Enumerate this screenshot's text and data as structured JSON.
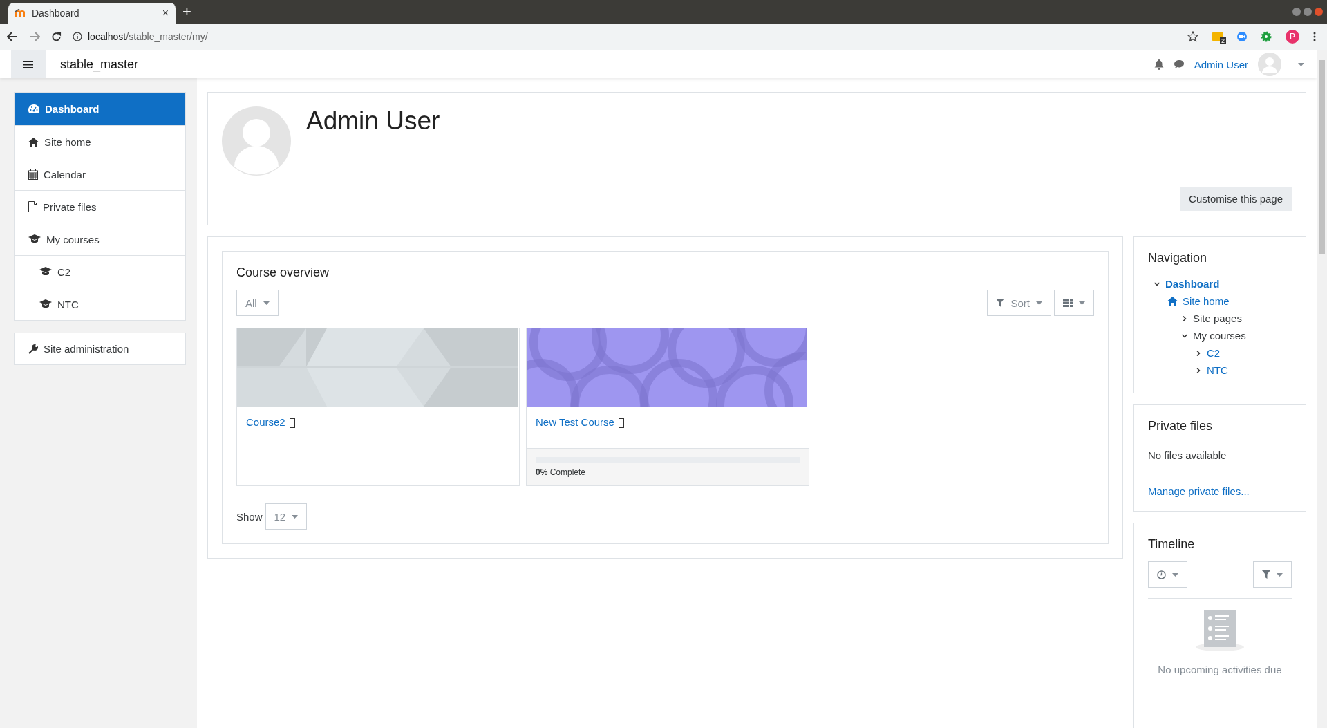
{
  "browser": {
    "tab_title": "Dashboard",
    "tab_close": "×",
    "new_tab": "+",
    "url_host": "localhost",
    "url_path": "/stable_master/my/",
    "extension_badge": "2",
    "profile_initial": "P"
  },
  "navbar": {
    "site_name": "stable_master",
    "user_name": "Admin User"
  },
  "drawer": {
    "items": [
      {
        "label": "Dashboard",
        "kind": "dashboard",
        "selected": true
      },
      {
        "label": "Site home",
        "kind": "home",
        "selected": false
      },
      {
        "label": "Calendar",
        "kind": "calendar",
        "selected": false
      },
      {
        "label": "Private files",
        "kind": "file",
        "selected": false
      },
      {
        "label": "My courses",
        "kind": "courses",
        "selected": false,
        "children": [
          {
            "label": "C2",
            "kind": "courses",
            "selected": false
          },
          {
            "label": "NTC",
            "kind": "courses",
            "selected": false
          }
        ]
      }
    ],
    "admin": {
      "label": "Site administration"
    }
  },
  "header": {
    "name": "Admin User",
    "customise_button": "Customise this page"
  },
  "course_overview": {
    "title": "Course overview",
    "filter": "All",
    "sort": "Sort",
    "courses": [
      {
        "name": "Course2",
        "kind": "hexagons"
      },
      {
        "name": "New Test Course",
        "kind": "circles",
        "progress": {
          "level": 0,
          "percent": "0%",
          "label": "Complete"
        }
      }
    ],
    "show_label": "Show",
    "per_page": "12"
  },
  "navigation_block": {
    "title": "Navigation",
    "tree": [
      {
        "label": "Dashboard",
        "kind": "branch",
        "expanded": true,
        "link": true,
        "current": true,
        "children": [
          {
            "label": "Site home",
            "kind": "home",
            "link": true,
            "current": false,
            "children": [
              {
                "label": "Site pages",
                "kind": "branch",
                "expanded": false,
                "link": false,
                "current": false
              },
              {
                "label": "My courses",
                "kind": "branch",
                "expanded": true,
                "link": false,
                "current": false,
                "children": [
                  {
                    "label": "C2",
                    "kind": "branch",
                    "expanded": false,
                    "link": true,
                    "current": false
                  },
                  {
                    "label": "NTC",
                    "kind": "branch",
                    "expanded": false,
                    "link": true,
                    "current": false
                  }
                ]
              }
            ]
          }
        ]
      }
    ]
  },
  "private_files_block": {
    "title": "Private files",
    "message": "No files available",
    "link": "Manage private files..."
  },
  "timeline_block": {
    "title": "Timeline",
    "empty_message": "No upcoming activities due"
  }
}
